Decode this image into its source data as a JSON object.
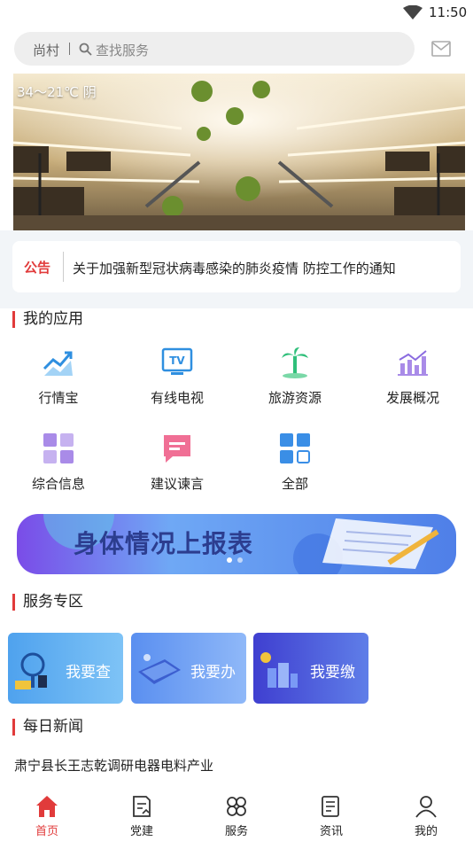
{
  "status_bar": {
    "time": "11:50"
  },
  "search": {
    "village": "尚村",
    "placeholder": "查找服务"
  },
  "banner": {
    "weather": "34～21℃ 阴"
  },
  "notice": {
    "tag": "公告",
    "text": "关于加强新型冠状病毒感染的肺炎疫情 防控工作的通知"
  },
  "my_apps": {
    "title": "我的应用",
    "items": [
      {
        "label": "行情宝",
        "icon": "trend-chart-icon"
      },
      {
        "label": "有线电视",
        "icon": "tv-icon"
      },
      {
        "label": "旅游资源",
        "icon": "palm-tree-icon"
      },
      {
        "label": "发展概况",
        "icon": "bar-growth-icon"
      },
      {
        "label": "综合信息",
        "icon": "grid-info-icon"
      },
      {
        "label": "建议谏言",
        "icon": "message-icon"
      },
      {
        "label": "全部",
        "icon": "all-grid-icon"
      }
    ]
  },
  "report_banner": {
    "title": "身体情况上报表"
  },
  "service_zone": {
    "title": "服务专区",
    "items": [
      {
        "label": "我要查"
      },
      {
        "label": "我要办"
      },
      {
        "label": "我要缴"
      }
    ]
  },
  "daily_news": {
    "title": "每日新闻",
    "items": [
      "肃宁县长王志乾调研电器电料产业"
    ]
  },
  "bottom_nav": {
    "active_color": "#e13b3b",
    "tabs": [
      {
        "label": "首页",
        "icon": "home-icon",
        "active": true
      },
      {
        "label": "党建",
        "icon": "party-doc-icon",
        "active": false
      },
      {
        "label": "服务",
        "icon": "services-icon",
        "active": false
      },
      {
        "label": "资讯",
        "icon": "news-icon",
        "active": false
      },
      {
        "label": "我的",
        "icon": "user-icon",
        "active": false
      }
    ]
  }
}
